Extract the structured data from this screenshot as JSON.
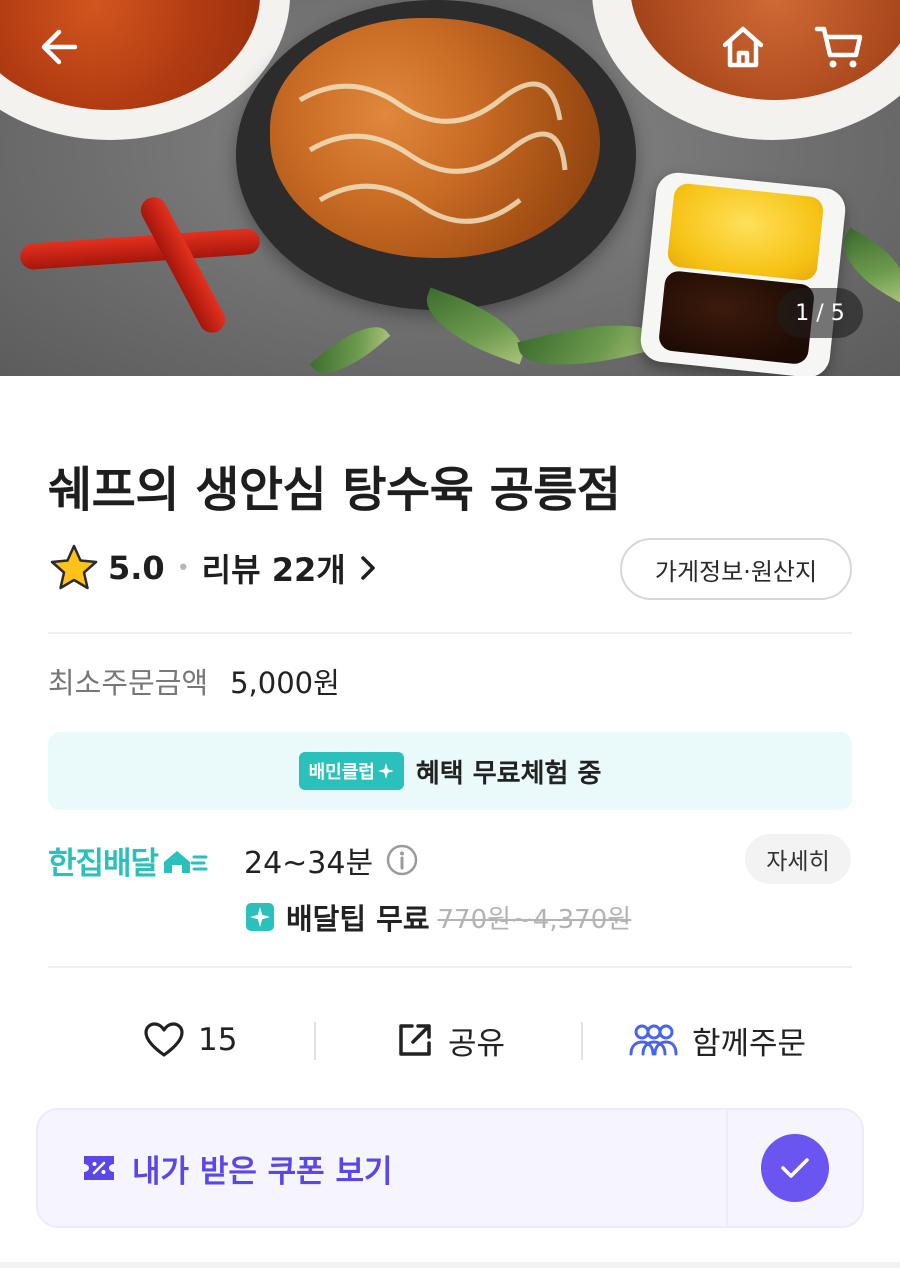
{
  "hero": {
    "counter": "1 / 5",
    "icons": {
      "back": "arrow-left-icon",
      "home": "home-icon",
      "cart": "cart-icon"
    }
  },
  "store": {
    "name": "쉐프의 생안심 탕수육 공릉점",
    "rating": "5.0",
    "review_label": "리뷰 22개",
    "info_button": "가게정보·원산지"
  },
  "order": {
    "min_label": "최소주문금액",
    "min_value": "5,000원"
  },
  "club": {
    "badge": "배민클럽",
    "text": "혜택 무료체험 중"
  },
  "delivery": {
    "type": "한집배달",
    "time": "24~34분",
    "detail_button": "자세히",
    "tip_label": "배달팁 무료",
    "tip_original": "770원~4,370원"
  },
  "actions": {
    "like_count": "15",
    "share_label": "공유",
    "group_label": "함께주문"
  },
  "coupon": {
    "label": "내가 받은 쿠폰 보기"
  },
  "colors": {
    "mint": "#2ac1bc",
    "purple": "#5a47e6",
    "purple_circle": "#6a55f0",
    "group_blue": "#4a64e8"
  }
}
